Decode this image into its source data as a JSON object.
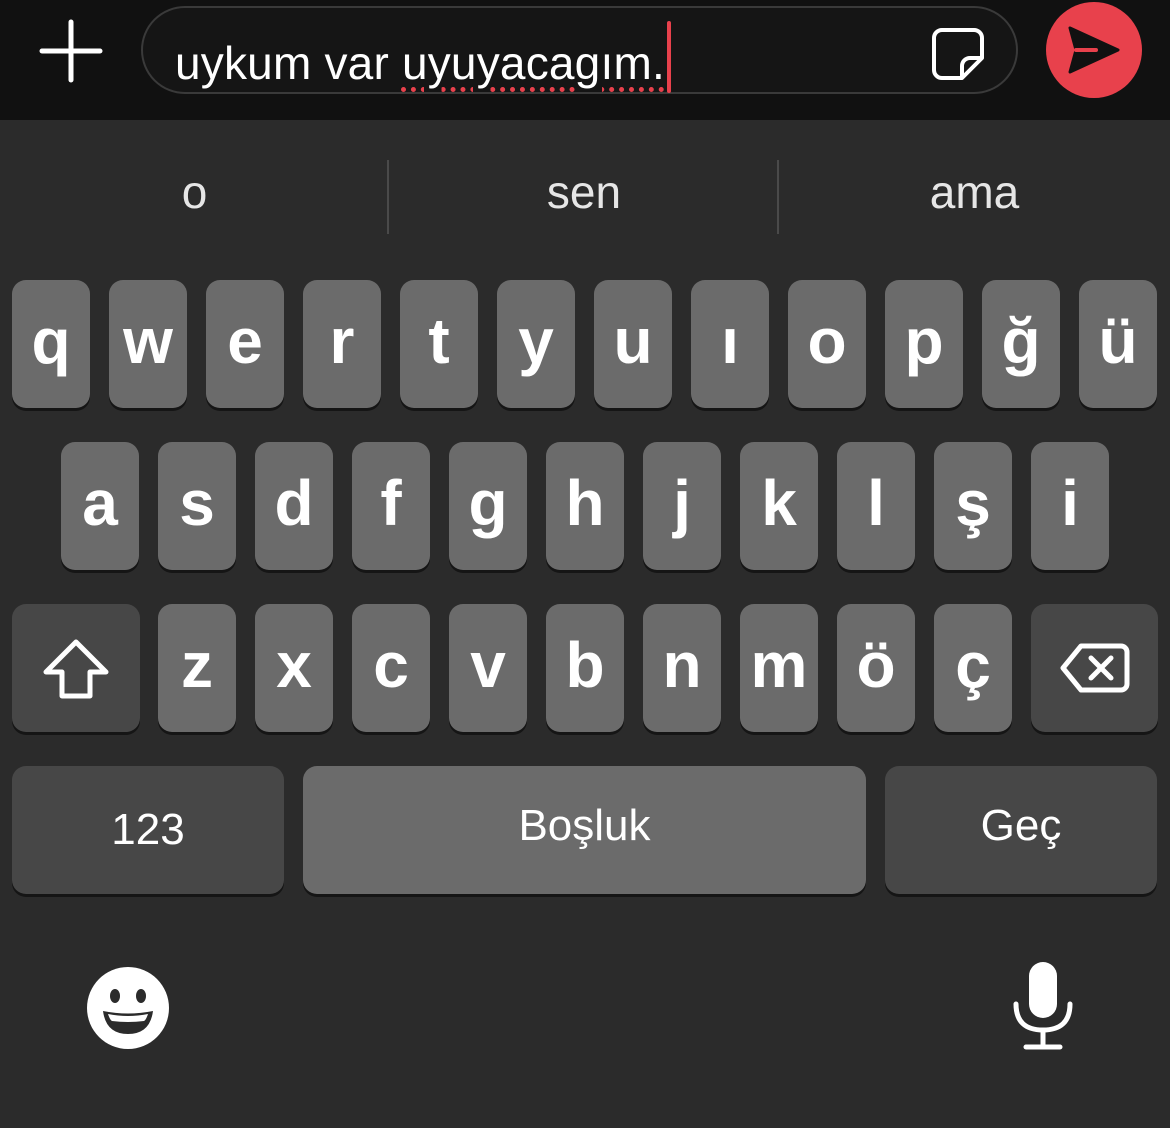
{
  "composer": {
    "text_before": "uykum var ",
    "misspelled_word": "uyuyacagım.",
    "add_icon": "plus-icon",
    "sticker_icon": "sticker-icon",
    "send_icon": "send-icon",
    "accent_color": "#e8414c"
  },
  "suggestions": [
    "o",
    "sen",
    "ama"
  ],
  "keyboard": {
    "row1": [
      "q",
      "w",
      "e",
      "r",
      "t",
      "y",
      "u",
      "ı",
      "o",
      "p",
      "ğ",
      "ü"
    ],
    "row2": [
      "a",
      "s",
      "d",
      "f",
      "g",
      "h",
      "j",
      "k",
      "l",
      "ş",
      "i"
    ],
    "row3": [
      "z",
      "x",
      "c",
      "v",
      "b",
      "n",
      "m",
      "ö",
      "ç"
    ],
    "shift_icon": "shift-icon",
    "backspace_icon": "backspace-icon",
    "numbers_label": "123",
    "space_label": "Boşluk",
    "return_label": "Geç",
    "emoji_icon": "emoji-icon",
    "mic_icon": "microphone-icon"
  }
}
